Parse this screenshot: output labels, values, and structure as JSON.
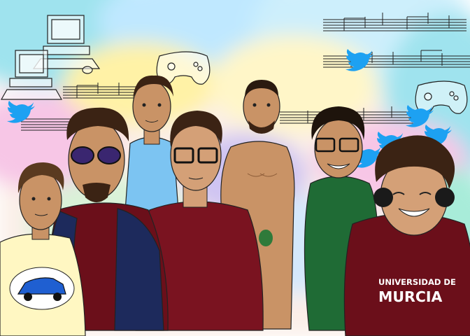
{
  "scene": {
    "colors": {
      "sky_cyan": "#9fe3ee",
      "sky_pink": "#f7c6e6",
      "sky_yellow": "#fff2a6",
      "sky_lavender": "#cfc4f2",
      "twitter_blue": "#1da1f2",
      "hoodie_dark_red": "#6b0f1a",
      "shirt_maroon": "#7a1320",
      "shirt_light_blue": "#7cc4f2",
      "shirt_green": "#1f6b35",
      "tee_cream": "#fff7c2",
      "skin": "#c99366",
      "hair": "#3b2314",
      "car_blue": "#1f5fd1",
      "jacket_navy": "#1d2a5c"
    },
    "hoodie_text": {
      "line1": "UNIVERSIDAD DE",
      "line2": "MURCIA"
    },
    "icons": [
      "computer-icon",
      "gamepad-icon",
      "twitter-bird-icon",
      "music-notes-icon",
      "rocket-car-icon"
    ]
  }
}
